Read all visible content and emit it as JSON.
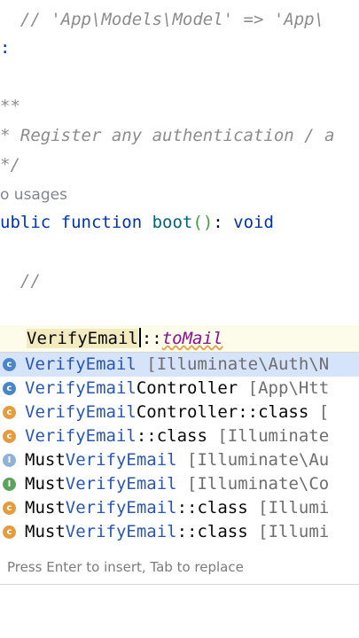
{
  "editor": {
    "line1": "  // 'App\\Models\\Model' => 'App\\",
    "line2": ":",
    "line3": "**",
    "line4": "* Register any authentication / a",
    "line5": "*/",
    "usages": "o usages",
    "sig_kw1": "ublic function",
    "sig_fn": "boot",
    "sig_paren": "()",
    "sig_colon": ":",
    "sig_void": "void",
    "line_comment": "  //",
    "current_ident": "VerifyEmail",
    "current_sep": "::",
    "current_member": "toMail"
  },
  "completion": {
    "items": [
      {
        "icon": "c",
        "match": "VerifyEmail",
        "rest": "",
        "suffix": " [Illuminate\\Auth\\N",
        "selected": true
      },
      {
        "icon": "c",
        "match": "VerifyEmail",
        "rest": "Controller",
        "suffix": " [App\\Htt"
      },
      {
        "icon": "c",
        "match": "VerifyEmail",
        "rest": "Controller::class",
        "suffix": " ["
      },
      {
        "icon": "c",
        "match": "VerifyEmail",
        "rest": "::class",
        "suffix": " [Illuminate"
      },
      {
        "icon": "I",
        "prefix": "Must",
        "match": "VerifyEmail",
        "suffix": " [Illuminate\\Au"
      },
      {
        "icon": "I",
        "prefix": "Must",
        "match": "VerifyEmail",
        "suffix": " [Illuminate\\Co"
      },
      {
        "icon": "c",
        "prefix": "Must",
        "match": "VerifyEmail",
        "rest": "::class",
        "suffix": " [Illumi"
      },
      {
        "icon": "c",
        "prefix": "Must",
        "match": "VerifyEmail",
        "rest": "::class",
        "suffix": " [Illumi"
      }
    ],
    "hint": "Press Enter to insert, Tab to replace"
  }
}
